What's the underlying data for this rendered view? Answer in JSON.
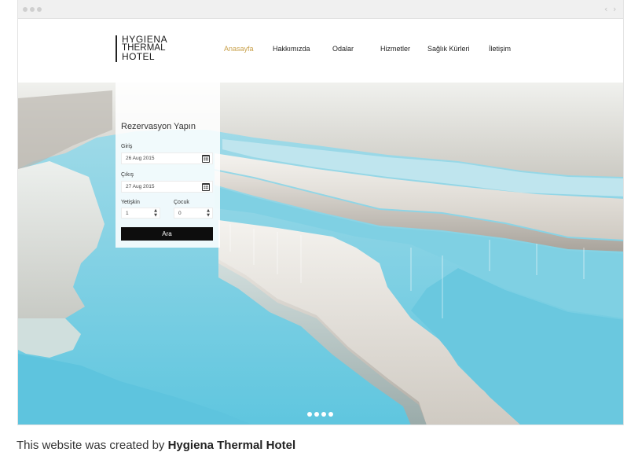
{
  "header": {
    "logo": {
      "line1": "HYGIENA",
      "line2": "THERMAL",
      "line3": "HOTEL"
    },
    "nav": [
      {
        "label": "Anasayfa",
        "active": true
      },
      {
        "label": "Hakkımızda",
        "active": false
      },
      {
        "label": "Odalar",
        "active": false
      },
      {
        "label": "Hizmetler",
        "active": false
      },
      {
        "label": "Sağlık Kürleri",
        "active": false
      },
      {
        "label": "İletişim",
        "active": false
      }
    ],
    "accent_color": "#c8a04a"
  },
  "booking": {
    "title": "Rezervasyon Yapın",
    "checkin_label": "Giriş",
    "checkin_value": "26 Aug 2015",
    "checkout_label": "Çıkış",
    "checkout_value": "27 Aug 2015",
    "adults_label": "Yetişkin",
    "adults_value": "1",
    "children_label": "Çocuk",
    "children_value": "0",
    "search_label": "Ara",
    "calendar_icon": "calendar-icon"
  },
  "slider": {
    "dot_count": 4
  },
  "credit": {
    "prefix": "This website was created by",
    "name": "Hygiena Thermal Hotel"
  }
}
